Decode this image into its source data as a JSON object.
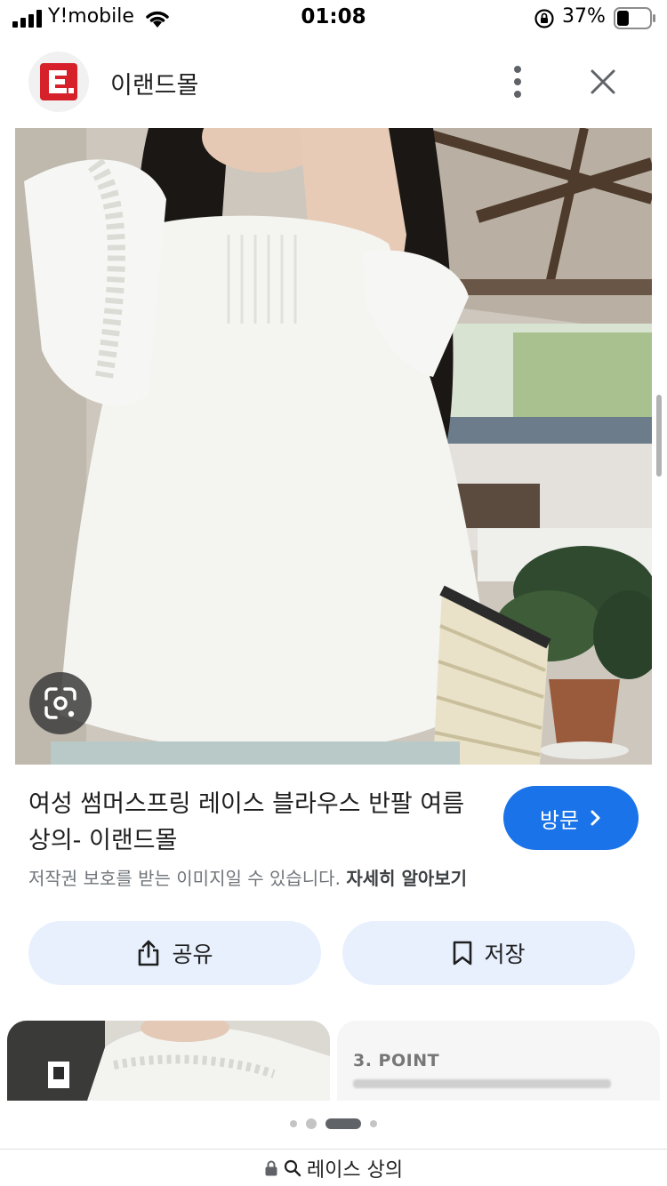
{
  "status": {
    "carrier": "Y!mobile",
    "time": "01:08",
    "battery_percent": "37%",
    "battery_level": 0.37
  },
  "header": {
    "site_name": "이랜드몰",
    "logo_text": "E."
  },
  "result": {
    "title": "여성 썸머스프링 레이스 블라우스 반팔 여름 상의- 이랜드몰",
    "visit_label": "방문",
    "copyright_text": "저작권 보호를 받는 이미지일 수 있습니다.",
    "learn_more_label": "자세히 알아보기"
  },
  "actions": {
    "share_label": "공유",
    "save_label": "저장"
  },
  "related": {
    "thumb2_heading": "3. POINT"
  },
  "address_bar": {
    "query": "레이스 상의"
  },
  "colors": {
    "accent": "#1a73e8",
    "action_bg": "#e8f0fe",
    "logo_red": "#d6202a"
  },
  "icons": [
    "signal-icon",
    "wifi-icon",
    "rotation-lock-icon",
    "battery-icon",
    "more-vert-icon",
    "close-icon",
    "lens-icon",
    "chevron-right-icon",
    "share-icon",
    "bookmark-icon",
    "lock-icon",
    "search-icon"
  ]
}
